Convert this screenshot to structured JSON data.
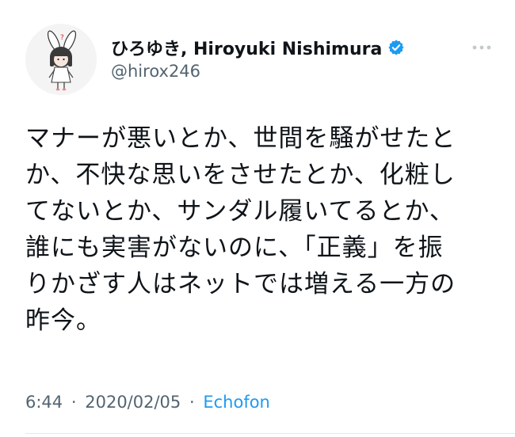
{
  "tweet": {
    "author": {
      "display_name": "ひろゆき, Hiroyuki Nishimura",
      "handle": "@hirox246",
      "verified": true,
      "avatar_icon": "avatar-bunny-girl-icon"
    },
    "more_icon": "more-dots-icon",
    "body_lines": [
      "マナーが悪いとか、世間を騒がせたと",
      "か、不快な思いをさせたとか、化粧し",
      "てないとか、サンダル履いてるとか、",
      "誰にも実害がないのに、「正義」を振",
      "りかざす人はネットでは増える一方の",
      "昨今。"
    ],
    "meta": {
      "time": "6:44",
      "date": "2020/02/05",
      "client": "Echofon",
      "separator": "·"
    },
    "colors": {
      "text": "#0f1419",
      "secondary": "#536471",
      "link": "#1d9bf0",
      "verified_badge": "#1d9bf0"
    }
  }
}
